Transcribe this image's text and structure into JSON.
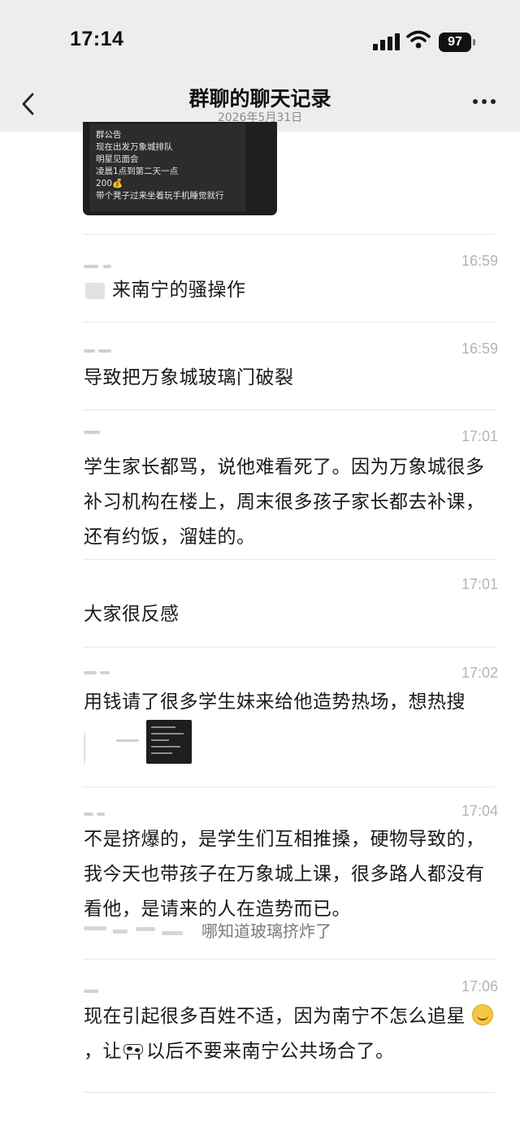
{
  "status_bar": {
    "time": "17:14",
    "battery": "97",
    "icons": [
      "signal-icon",
      "wifi-icon",
      "battery-icon"
    ]
  },
  "nav": {
    "title": "群聊的聊天记录",
    "subtitle": "2026年5月31日",
    "icons": [
      "back-icon",
      "more-icon"
    ]
  },
  "notice": {
    "lines": [
      "群公告",
      "现在出发万象城排队",
      "明星见面会",
      "凌晨1点到第二天一点",
      "200💰",
      "带个凳子过来坐着玩手机睡觉就行"
    ]
  },
  "messages": [
    {
      "time": "16:59",
      "text": "来南宁的骚操作"
    },
    {
      "time": "16:59",
      "text": "导致把万象城玻璃门破裂"
    },
    {
      "time": "17:01",
      "text": "学生家长都骂，说他难看死了。因为万象城很多补习机构在楼上，周末很多孩子家长都去补课，还有约饭，溜娃的。"
    },
    {
      "time": "17:01",
      "text": "大家很反感"
    },
    {
      "time": "17:02",
      "text": "用钱请了很多学生妹来给他造势热场，想热搜"
    },
    {
      "time": "17:04",
      "text": "不是挤爆的，是学生们互相推搡，硬物导致的，我今天也带孩子在万象城上课，很多路人都没有看他，是请来的人在造势而已。",
      "quote": "哪知道玻璃挤炸了"
    },
    {
      "time": "17:06",
      "text_before_emoji": "现在引起很多百姓不适，因为南宁不怎么追星",
      "text_mid": "，让",
      "text_after": "以后不要来南宁公共场合了。",
      "emojis": [
        "laughing-emoji-icon",
        "cow-emoji-icon"
      ]
    }
  ]
}
